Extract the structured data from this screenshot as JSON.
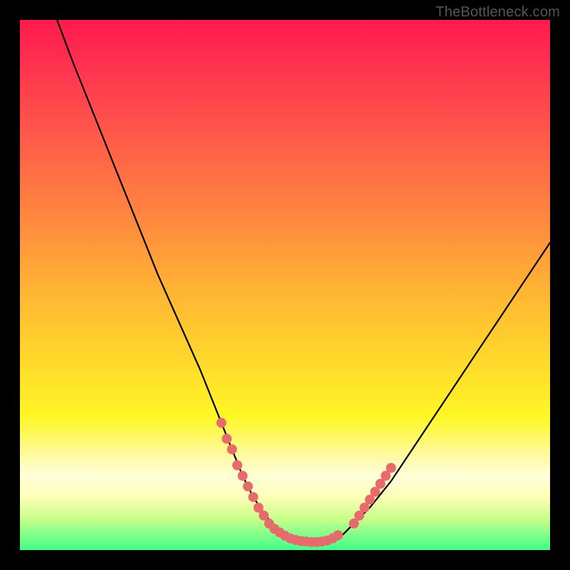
{
  "watermark": "TheBottleneck.com",
  "chart_data": {
    "type": "line",
    "title": "",
    "xlabel": "",
    "ylabel": "",
    "xlim": [
      0,
      100
    ],
    "ylim": [
      0,
      100
    ],
    "series": [
      {
        "name": "bottleneck-curve",
        "x": [
          7,
          10,
          14,
          18,
          22,
          26,
          30,
          34,
          38,
          40,
          42,
          44,
          46,
          48,
          50,
          52,
          54,
          56,
          58,
          60,
          62,
          66,
          70,
          74,
          78,
          82,
          86,
          90,
          94,
          98,
          100
        ],
        "y": [
          100,
          92,
          82,
          72,
          62,
          52,
          43,
          34,
          24,
          19,
          14,
          10,
          7,
          4.5,
          3,
          2,
          1.5,
          1.4,
          1.5,
          2,
          4,
          8,
          13,
          19,
          25,
          31,
          37,
          43,
          49,
          55,
          58
        ]
      }
    ],
    "dot_clusters": [
      {
        "name": "left-cluster",
        "points": [
          {
            "x": 38,
            "y": 24
          },
          {
            "x": 39,
            "y": 21
          },
          {
            "x": 40,
            "y": 19
          },
          {
            "x": 41,
            "y": 16
          },
          {
            "x": 42,
            "y": 14
          },
          {
            "x": 43,
            "y": 12
          },
          {
            "x": 44,
            "y": 10
          },
          {
            "x": 45,
            "y": 8
          },
          {
            "x": 46,
            "y": 6.5
          },
          {
            "x": 47,
            "y": 5
          },
          {
            "x": 48,
            "y": 4
          },
          {
            "x": 49,
            "y": 3.3
          }
        ]
      },
      {
        "name": "bottom-cluster",
        "points": [
          {
            "x": 50,
            "y": 2.7
          },
          {
            "x": 51,
            "y": 2.2
          },
          {
            "x": 52,
            "y": 1.9
          },
          {
            "x": 53,
            "y": 1.7
          },
          {
            "x": 54,
            "y": 1.6
          },
          {
            "x": 55,
            "y": 1.5
          },
          {
            "x": 56,
            "y": 1.5
          },
          {
            "x": 57,
            "y": 1.6
          },
          {
            "x": 58,
            "y": 1.8
          },
          {
            "x": 59,
            "y": 2.2
          },
          {
            "x": 60,
            "y": 2.8
          }
        ]
      },
      {
        "name": "right-cluster",
        "points": [
          {
            "x": 63,
            "y": 5
          },
          {
            "x": 64,
            "y": 6.5
          },
          {
            "x": 65,
            "y": 8
          },
          {
            "x": 66,
            "y": 9.5
          },
          {
            "x": 67,
            "y": 11
          },
          {
            "x": 68,
            "y": 12.5
          },
          {
            "x": 69,
            "y": 14
          },
          {
            "x": 70,
            "y": 15.5
          }
        ]
      }
    ],
    "dot_color": "#e96a6a",
    "curve_color": "#000000"
  }
}
